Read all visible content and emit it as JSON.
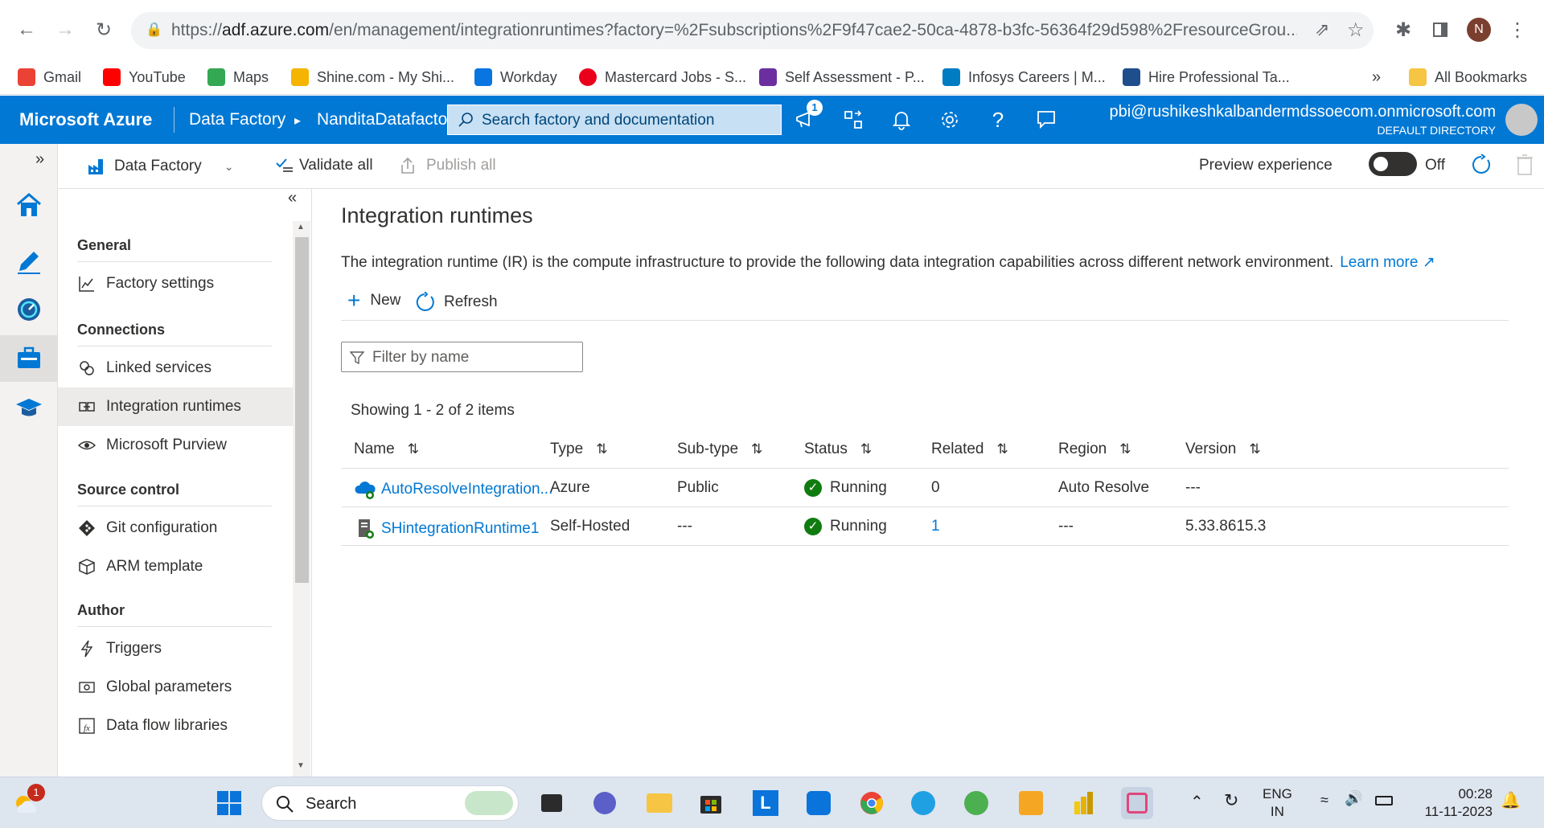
{
  "browser": {
    "url": "https://adf.azure.com/en/management/integrationruntimes?factory=%2Fsubscriptions%2F9f47cae2-50ca-4878-b3fc-56364f29d598%2FresourceGrou...",
    "url_host": "adf.azure.com",
    "url_prefix": "https://",
    "url_suffix": "/en/management/integrationruntimes?factory=%2Fsubscriptions%2F9f47cae2-50ca-4878-b3fc-56364f29d598%2FresourceGrou...",
    "profile_initial": "N",
    "bookmarks": [
      {
        "label": "Gmail",
        "color": "#ea4335"
      },
      {
        "label": "YouTube",
        "color": "#ff0000"
      },
      {
        "label": "Maps",
        "color": "#34a853"
      },
      {
        "label": "Shine.com - My Shi...",
        "color": "#f4b400"
      },
      {
        "label": "Workday",
        "color": "#0875e1"
      },
      {
        "label": "Mastercard Jobs - S...",
        "color": "#eb001b"
      },
      {
        "label": "Self Assessment - P...",
        "color": "#6b2fa0"
      },
      {
        "label": "Infosys Careers | M...",
        "color": "#007cc3"
      },
      {
        "label": "Hire Professional Ta...",
        "color": "#1f4e8c"
      }
    ],
    "more_bookmarks": "»",
    "all_bookmarks": "All Bookmarks"
  },
  "azure": {
    "brand": "Microsoft Azure",
    "crumb1": "Data Factory",
    "crumb_sep": "▸",
    "crumb2": "NanditaDatafacto",
    "search_placeholder": "Search factory and documentation",
    "notification_count": "1",
    "account_email": "pbi@rushikeshkalbandermdssoecom.onmicrosoft.com",
    "account_dir": "DEFAULT DIRECTORY"
  },
  "toolbar": {
    "factory_label": "Data Factory",
    "validate_all": "Validate all",
    "publish_all": "Publish all",
    "preview_label": "Preview experience",
    "toggle_state": "Off"
  },
  "nav": {
    "general": "General",
    "factory_settings": "Factory settings",
    "connections": "Connections",
    "linked_services": "Linked services",
    "integration_runtimes": "Integration runtimes",
    "microsoft_purview": "Microsoft Purview",
    "source_control": "Source control",
    "git_configuration": "Git configuration",
    "arm_template": "ARM template",
    "author": "Author",
    "triggers": "Triggers",
    "global_parameters": "Global parameters",
    "data_flow_libraries": "Data flow libraries"
  },
  "main": {
    "title": "Integration runtimes",
    "description": "The integration runtime (IR) is the compute infrastructure to provide the following data integration capabilities across different network environment.",
    "learn_more": "Learn more",
    "new_label": "New",
    "refresh_label": "Refresh",
    "filter_placeholder": "Filter by name",
    "showing": "Showing 1 - 2 of 2 items",
    "columns": [
      "Name",
      "Type",
      "Sub-type",
      "Status",
      "Related",
      "Region",
      "Version"
    ],
    "rows": [
      {
        "name": "AutoResolveIntegration...",
        "type": "Azure",
        "subtype": "Public",
        "status": "Running",
        "related": "0",
        "region": "Auto Resolve",
        "version": "---"
      },
      {
        "name": "SHintegrationRuntime1",
        "type": "Self-Hosted",
        "subtype": "---",
        "status": "Running",
        "related": "1",
        "region": "---",
        "version": "5.33.8615.3"
      }
    ]
  },
  "taskbar": {
    "search_label": "Search",
    "weather_badge": "1",
    "lang_top": "ENG",
    "lang_bottom": "IN",
    "time": "00:28",
    "date": "11-11-2023"
  }
}
